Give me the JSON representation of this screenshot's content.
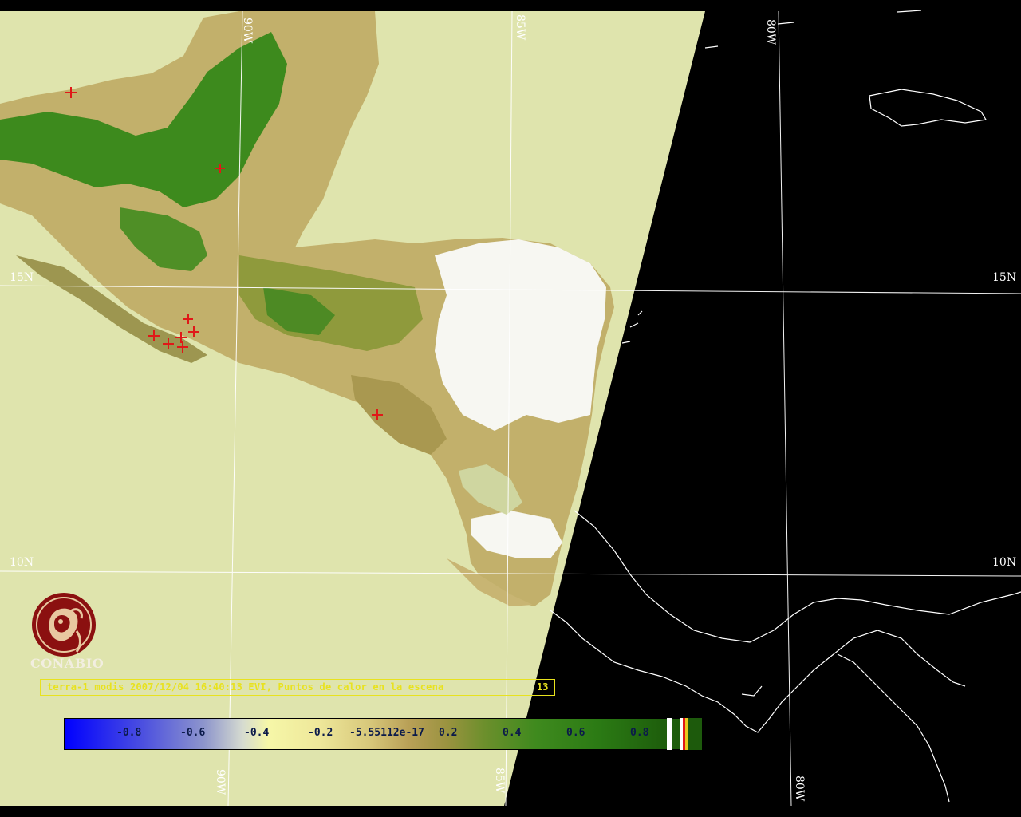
{
  "map": {
    "title": "CONABIO",
    "caption": "terra-1 modis 2007/12/04 16:40:13 EVI, Puntos de calor en la escena",
    "hotspot_count": "13",
    "grid_labels": {
      "lon_top_90": "90W",
      "lon_top_85": "85W",
      "lon_top_80": "80W",
      "lon_bottom_90": "90W",
      "lon_bottom_85": "85W",
      "lon_bottom_80": "80W",
      "lat_15_left": "15N",
      "lat_15_right": "15N",
      "lat_10_left": "10N",
      "lat_10_right": "10N"
    },
    "colorbar": {
      "labels": [
        "-0.8",
        "-0.6",
        "-0.4",
        "-0.2",
        "-5.55112e-17",
        "0.2",
        "0.4",
        "0.6",
        "0.8"
      ],
      "legend_type": "EVI"
    },
    "colors": {
      "background": "#000000",
      "swath": "#dfe4ad",
      "vegetation_dense": "#2f7d16",
      "vegetation_sparse": "#b9a35a",
      "cloud": "#ffffff",
      "hotspot": "#e01818",
      "caption": "#e8e21e",
      "coastline": "#ffffff",
      "logo": "#8b1010"
    }
  }
}
